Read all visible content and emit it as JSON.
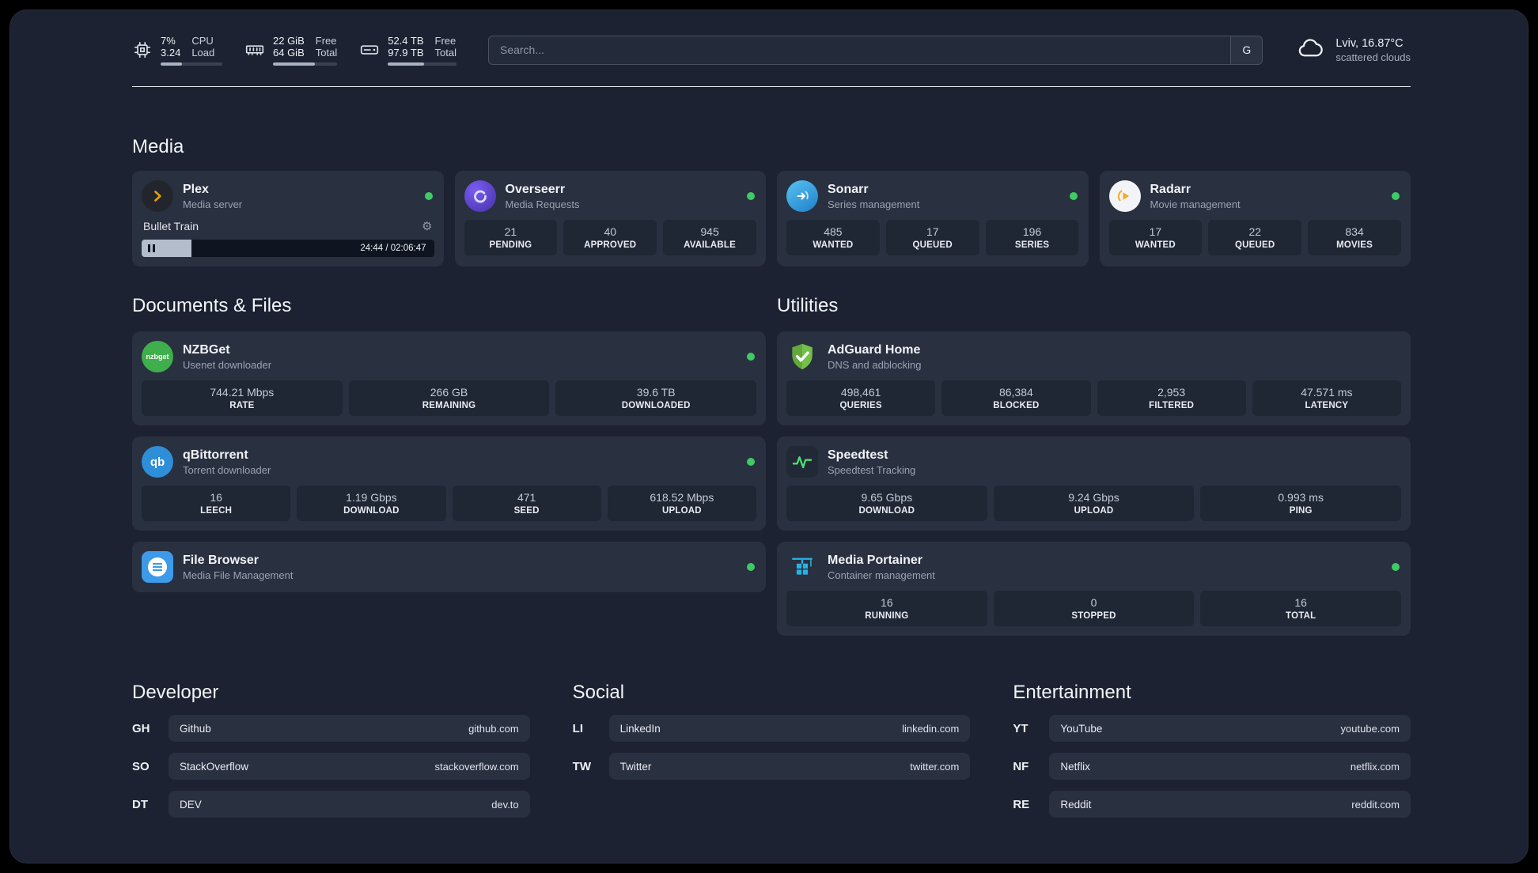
{
  "topbar": {
    "cpu": {
      "percent": "7%",
      "load": "3.24",
      "label_top": "CPU",
      "label_bottom": "Load",
      "bar_percent": 35
    },
    "ram": {
      "free": "22 GiB",
      "total": "64 GiB",
      "label_top": "Free",
      "label_bottom": "Total",
      "bar_percent": 65
    },
    "disk": {
      "free": "52.4 TB",
      "total": "97.9 TB",
      "label_top": "Free",
      "label_bottom": "Total",
      "bar_percent": 53
    },
    "search": {
      "placeholder": "Search...",
      "button_label": "G"
    },
    "weather": {
      "location": "Lviv, 16.87°C",
      "condition": "scattered clouds"
    }
  },
  "icons": {
    "gear": "⚙",
    "nzbget_logo_text": "nzbget",
    "qbittorrent_logo_text": "qb"
  },
  "colors": {
    "status_online": "#3ecb63",
    "panel_bg": "#1c2231",
    "card_bg": "#293040"
  },
  "sections": {
    "media": {
      "title": "Media",
      "plex": {
        "title": "Plex",
        "subtitle": "Media server",
        "now_playing": "Bullet Train",
        "time": "24:44 / 02:06:47",
        "progress_percent": 17
      },
      "overseerr": {
        "title": "Overseerr",
        "subtitle": "Media Requests",
        "stats": [
          {
            "value": "21",
            "label": "PENDING"
          },
          {
            "value": "40",
            "label": "APPROVED"
          },
          {
            "value": "945",
            "label": "AVAILABLE"
          }
        ]
      },
      "sonarr": {
        "title": "Sonarr",
        "subtitle": "Series management",
        "stats": [
          {
            "value": "485",
            "label": "WANTED"
          },
          {
            "value": "17",
            "label": "QUEUED"
          },
          {
            "value": "196",
            "label": "SERIES"
          }
        ]
      },
      "radarr": {
        "title": "Radarr",
        "subtitle": "Movie management",
        "stats": [
          {
            "value": "17",
            "label": "WANTED"
          },
          {
            "value": "22",
            "label": "QUEUED"
          },
          {
            "value": "834",
            "label": "MOVIES"
          }
        ]
      }
    },
    "documents": {
      "title": "Documents & Files",
      "nzbget": {
        "title": "NZBGet",
        "subtitle": "Usenet downloader",
        "stats": [
          {
            "value": "744.21 Mbps",
            "label": "RATE"
          },
          {
            "value": "266 GB",
            "label": "REMAINING"
          },
          {
            "value": "39.6 TB",
            "label": "DOWNLOADED"
          }
        ]
      },
      "qbittorrent": {
        "title": "qBittorrent",
        "subtitle": "Torrent downloader",
        "stats": [
          {
            "value": "16",
            "label": "LEECH"
          },
          {
            "value": "1.19 Gbps",
            "label": "DOWNLOAD"
          },
          {
            "value": "471",
            "label": "SEED"
          },
          {
            "value": "618.52 Mbps",
            "label": "UPLOAD"
          }
        ]
      },
      "filebrowser": {
        "title": "File Browser",
        "subtitle": "Media File Management"
      }
    },
    "utilities": {
      "title": "Utilities",
      "adguard": {
        "title": "AdGuard Home",
        "subtitle": "DNS and adblocking",
        "stats": [
          {
            "value": "498,461",
            "label": "QUERIES"
          },
          {
            "value": "86,384",
            "label": "BLOCKED"
          },
          {
            "value": "2,953",
            "label": "FILTERED"
          },
          {
            "value": "47.571 ms",
            "label": "LATENCY"
          }
        ]
      },
      "speedtest": {
        "title": "Speedtest",
        "subtitle": "Speedtest Tracking",
        "stats": [
          {
            "value": "9.65 Gbps",
            "label": "DOWNLOAD"
          },
          {
            "value": "9.24 Gbps",
            "label": "UPLOAD"
          },
          {
            "value": "0.993 ms",
            "label": "PING"
          }
        ]
      },
      "portainer": {
        "title": "Media Portainer",
        "subtitle": "Container management",
        "stats": [
          {
            "value": "16",
            "label": "RUNNING"
          },
          {
            "value": "0",
            "label": "STOPPED"
          },
          {
            "value": "16",
            "label": "TOTAL"
          }
        ]
      }
    },
    "developer": {
      "title": "Developer",
      "links": [
        {
          "abbr": "GH",
          "name": "Github",
          "url": "github.com"
        },
        {
          "abbr": "SO",
          "name": "StackOverflow",
          "url": "stackoverflow.com"
        },
        {
          "abbr": "DT",
          "name": "DEV",
          "url": "dev.to"
        }
      ]
    },
    "social": {
      "title": "Social",
      "links": [
        {
          "abbr": "LI",
          "name": "LinkedIn",
          "url": "linkedin.com"
        },
        {
          "abbr": "TW",
          "name": "Twitter",
          "url": "twitter.com"
        }
      ]
    },
    "entertainment": {
      "title": "Entertainment",
      "links": [
        {
          "abbr": "YT",
          "name": "YouTube",
          "url": "youtube.com"
        },
        {
          "abbr": "NF",
          "name": "Netflix",
          "url": "netflix.com"
        },
        {
          "abbr": "RE",
          "name": "Reddit",
          "url": "reddit.com"
        }
      ]
    }
  }
}
